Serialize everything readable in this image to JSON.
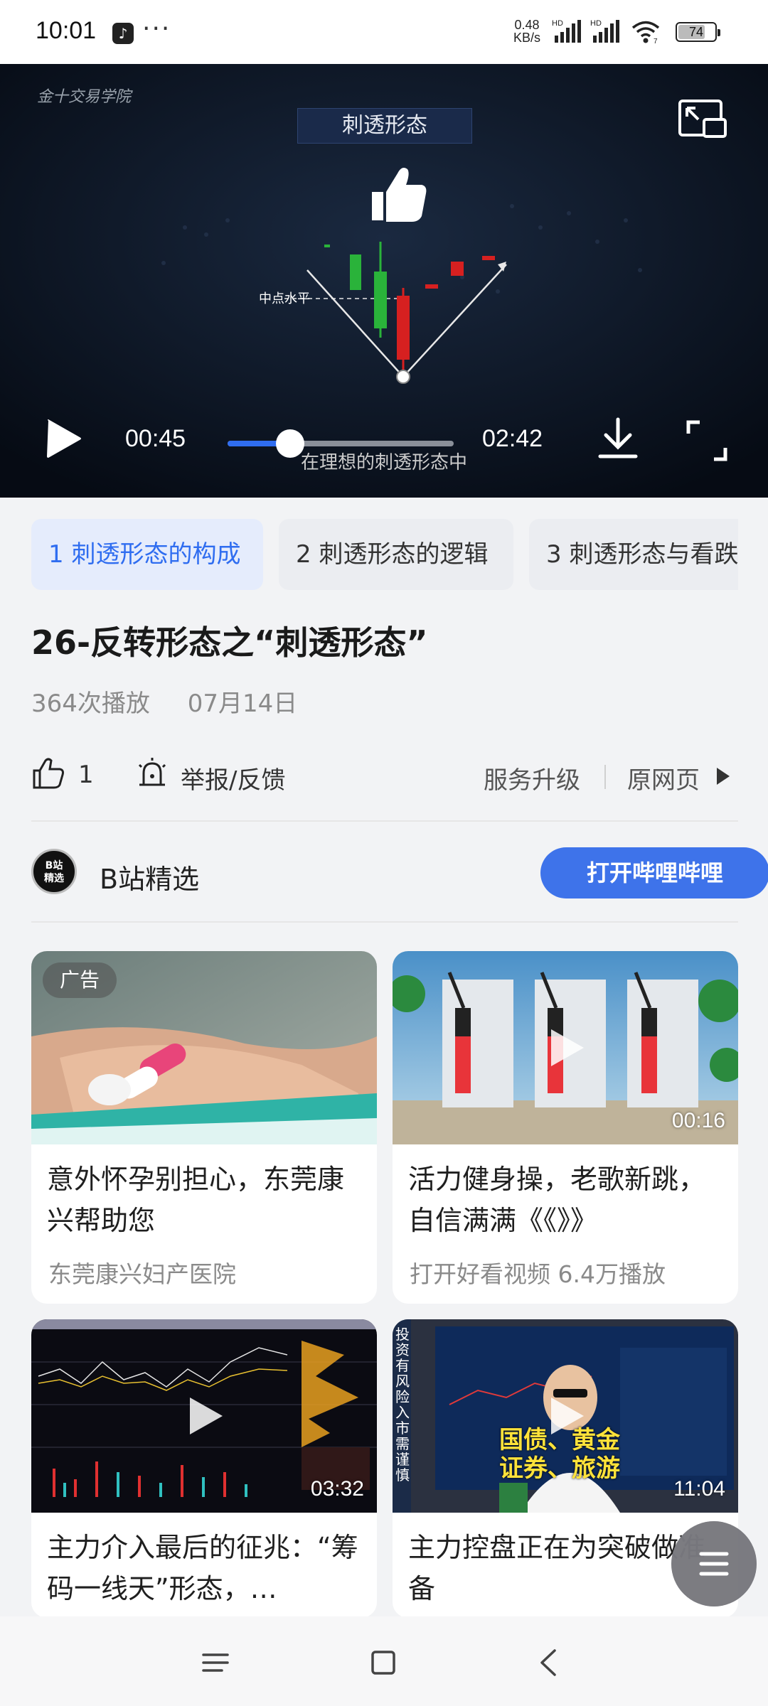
{
  "status_bar": {
    "time": "10:01",
    "net_speed_value": "0.48",
    "net_speed_unit": "KB/s",
    "hd_label": "HD",
    "wifi_badge": "7",
    "battery_level": "74",
    "more_dots": "···"
  },
  "player": {
    "watermark": "金十交易学院",
    "video_heading": "刺透形态",
    "chart_label": "中点水平",
    "subtitle": "在理想的刺透形态中",
    "current_time": "00:45",
    "total_time": "02:42",
    "progress_fraction": 0.278
  },
  "chapters": [
    {
      "label": "1 刺透形态的构成",
      "active": true
    },
    {
      "label": "2 刺透形态的逻辑",
      "active": false
    },
    {
      "label": "3 刺透形态与看跌",
      "active": false
    }
  ],
  "video": {
    "title": "26-反转形态之“刺透形态”",
    "plays": "364次播放",
    "date": "07月14日"
  },
  "actions": {
    "like_count": "1",
    "report": "举报/反馈",
    "upgrade": "服务升级",
    "original": "原网页"
  },
  "source": {
    "avatar_line1": "B站",
    "avatar_line2": "精选",
    "name": "B站精选",
    "open_button": "打开哔哩哔哩"
  },
  "cards": [
    {
      "badge": "广告",
      "title": "意外怀孕别担心，东莞康兴帮助您",
      "sub": "东莞康兴妇产医院",
      "duration": ""
    },
    {
      "badge": "",
      "title": "活力健身操，老歌新跳，自信满满《《》》",
      "sub": "打开好看视频   6.4万播放",
      "duration": "00:16"
    },
    {
      "badge": "",
      "title": "主力介入最后的征兆：“筹码一线天”形态，…",
      "sub": "",
      "duration": "03:32"
    },
    {
      "badge": "",
      "title": "主力控盘正在为突破做准备",
      "sub": "",
      "duration": "11:04"
    }
  ],
  "thumb_text": {
    "card4_overlay_line1": "国债、黄金",
    "card4_overlay_line2": "证券、旅游",
    "card4_side": "投资有风险 入市需谨慎"
  },
  "colors": {
    "accent": "#2f6df0",
    "button": "#3e73ea",
    "player_bg": "#0a1220"
  }
}
